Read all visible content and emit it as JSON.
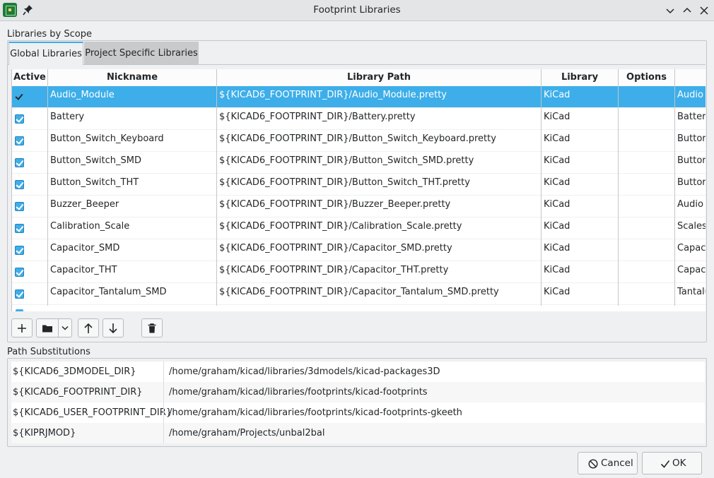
{
  "window": {
    "title": "Footprint Libraries"
  },
  "scope_group": {
    "label": "Libraries by Scope",
    "tabs": [
      {
        "label": "Global Libraries",
        "active": true
      },
      {
        "label": "Project Specific Libraries",
        "active": false
      }
    ]
  },
  "grid": {
    "columns": [
      "Active",
      "Nickname",
      "Library Path",
      "Library Format",
      "Options",
      ""
    ],
    "rows": [
      {
        "active": true,
        "nickname": "Audio_Module",
        "path": "${KICAD6_FOOTPRINT_DIR}/Audio_Module.pretty",
        "format": "KiCad",
        "options": "",
        "description": "Audio",
        "selected": true
      },
      {
        "active": true,
        "nickname": "Battery",
        "path": "${KICAD6_FOOTPRINT_DIR}/Battery.pretty",
        "format": "KiCad",
        "options": "",
        "description": "Batter"
      },
      {
        "active": true,
        "nickname": "Button_Switch_Keyboard",
        "path": "${KICAD6_FOOTPRINT_DIR}/Button_Switch_Keyboard.pretty",
        "format": "KiCad",
        "options": "",
        "description": "Buttor"
      },
      {
        "active": true,
        "nickname": "Button_Switch_SMD",
        "path": "${KICAD6_FOOTPRINT_DIR}/Button_Switch_SMD.pretty",
        "format": "KiCad",
        "options": "",
        "description": "Buttor"
      },
      {
        "active": true,
        "nickname": "Button_Switch_THT",
        "path": "${KICAD6_FOOTPRINT_DIR}/Button_Switch_THT.pretty",
        "format": "KiCad",
        "options": "",
        "description": "Buttor"
      },
      {
        "active": true,
        "nickname": "Buzzer_Beeper",
        "path": "${KICAD6_FOOTPRINT_DIR}/Buzzer_Beeper.pretty",
        "format": "KiCad",
        "options": "",
        "description": "Audio"
      },
      {
        "active": true,
        "nickname": "Calibration_Scale",
        "path": "${KICAD6_FOOTPRINT_DIR}/Calibration_Scale.pretty",
        "format": "KiCad",
        "options": "",
        "description": "Scales"
      },
      {
        "active": true,
        "nickname": "Capacitor_SMD",
        "path": "${KICAD6_FOOTPRINT_DIR}/Capacitor_SMD.pretty",
        "format": "KiCad",
        "options": "",
        "description": "Capaci"
      },
      {
        "active": true,
        "nickname": "Capacitor_THT",
        "path": "${KICAD6_FOOTPRINT_DIR}/Capacitor_THT.pretty",
        "format": "KiCad",
        "options": "",
        "description": "Capaci"
      },
      {
        "active": true,
        "nickname": "Capacitor_Tantalum_SMD",
        "path": "${KICAD6_FOOTPRINT_DIR}/Capacitor_Tantalum_SMD.pretty",
        "format": "KiCad",
        "options": "",
        "description": "Tantalu"
      }
    ]
  },
  "toolbar": {
    "buttons": [
      "add-icon",
      "folder-icon",
      "dropdown-icon",
      "move-up-icon",
      "move-down-icon",
      "delete-icon"
    ]
  },
  "path_substitutions": {
    "label": "Path Substitutions",
    "rows": [
      {
        "name": "${KICAD6_3DMODEL_DIR}",
        "path": "/home/graham/kicad/libraries/3dmodels/kicad-packages3D"
      },
      {
        "name": "${KICAD6_FOOTPRINT_DIR}",
        "path": "/home/graham/kicad/libraries/footprints/kicad-footprints"
      },
      {
        "name": "${KICAD6_USER_FOOTPRINT_DIR}",
        "path": "/home/graham/kicad/libraries/footprints/kicad-footprints-gkeeth"
      },
      {
        "name": "${KIPRJMOD}",
        "path": "/home/graham/Projects/unbal2bal"
      }
    ]
  },
  "buttons": {
    "cancel": "Cancel",
    "ok": "OK"
  },
  "colors": {
    "accent": "#3daee9",
    "window_bg": "#eff0f1"
  }
}
